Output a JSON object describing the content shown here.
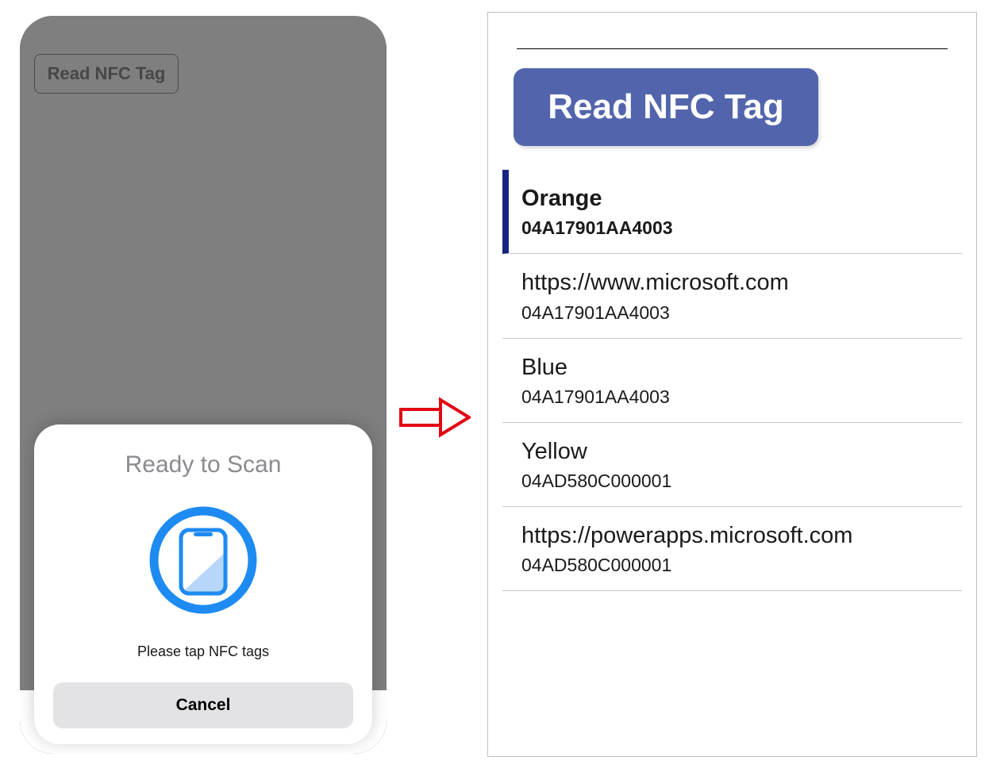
{
  "phone": {
    "read_button_label": "Read NFC Tag",
    "sheet_title": "Ready to Scan",
    "sheet_subtitle": "Please tap NFC tags",
    "cancel_label": "Cancel"
  },
  "icons": {
    "scan": "nfc-scan-icon",
    "arrow": "arrow-right-icon"
  },
  "pane": {
    "read_button_label": "Read NFC Tag",
    "rows": [
      {
        "title": "Orange",
        "sub": "04A17901AA4003",
        "selected": true
      },
      {
        "title": "https://www.microsoft.com",
        "sub": "04A17901AA4003",
        "selected": false
      },
      {
        "title": "Blue",
        "sub": "04A17901AA4003",
        "selected": false
      },
      {
        "title": "Yellow",
        "sub": "04AD580C000001",
        "selected": false
      },
      {
        "title": "https://powerapps.microsoft.com",
        "sub": "04AD580C000001",
        "selected": false
      }
    ]
  }
}
